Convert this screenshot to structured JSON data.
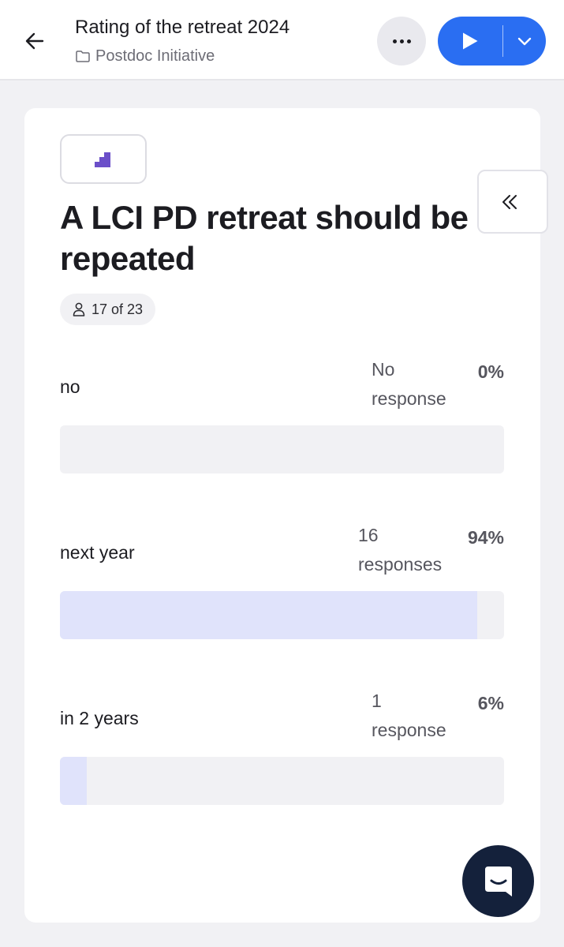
{
  "header": {
    "title": "Rating of the retreat 2024",
    "folder": "Postdoc Initiative",
    "icons": {
      "back": "arrow-left-icon",
      "folder": "folder-icon",
      "more": "more-horizontal-icon",
      "play": "play-icon",
      "dropdown": "chevron-down-icon"
    },
    "accent_color": "#2a6ef2"
  },
  "question": {
    "title": "A LCI PD retreat should be repeated",
    "type_icon": "ranking-stairs-icon",
    "type_icon_color": "#6b4fc9",
    "respondents": "17 of 23",
    "respondents_icon": "person-icon",
    "collapse_icon": "chevrons-left-icon"
  },
  "results": [
    {
      "label": "no",
      "count_line1": "No",
      "count_line2": "response",
      "percent_label": "0%",
      "fraction": 0.0
    },
    {
      "label": "next year",
      "count_line1": "16",
      "count_line2": "responses",
      "percent_label": "94%",
      "fraction": 0.94
    },
    {
      "label": "in 2 years",
      "count_line1": "1",
      "count_line2": "response",
      "percent_label": "6%",
      "fraction": 0.06
    }
  ],
  "bar_color": "#e0e3fb",
  "chat": {
    "icon": "chat-bubble-icon",
    "color": "#14213b"
  }
}
